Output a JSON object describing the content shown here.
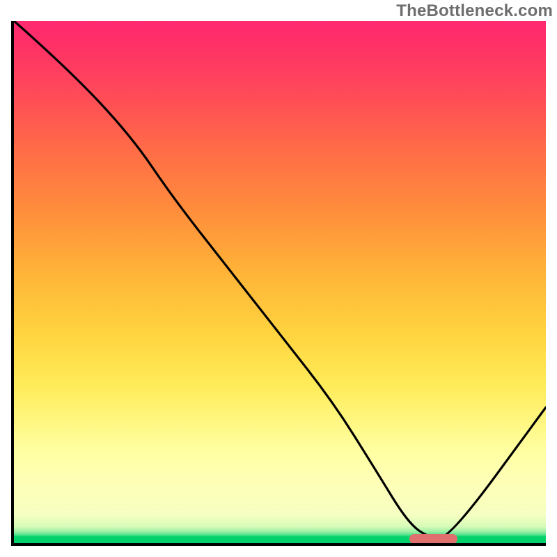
{
  "watermark": "TheBottleneck.com",
  "chart_data": {
    "type": "line",
    "title": "",
    "xlabel": "",
    "ylabel": "",
    "xlim": [
      0,
      100
    ],
    "ylim": [
      0,
      100
    ],
    "grid": false,
    "legend": false,
    "background": "heat-gradient (green bottom → red top)",
    "series": [
      {
        "name": "bottleneck-curve",
        "x": [
          0,
          10,
          22,
          30,
          40,
          50,
          60,
          68,
          74,
          78,
          82,
          100
        ],
        "y": [
          100,
          91,
          78,
          66,
          53,
          40,
          27,
          14,
          4,
          1,
          1,
          26
        ]
      }
    ],
    "marker": {
      "name": "optimal-range",
      "x_start": 74,
      "x_end": 83,
      "y": 0.8,
      "color": "#e0706e"
    }
  }
}
